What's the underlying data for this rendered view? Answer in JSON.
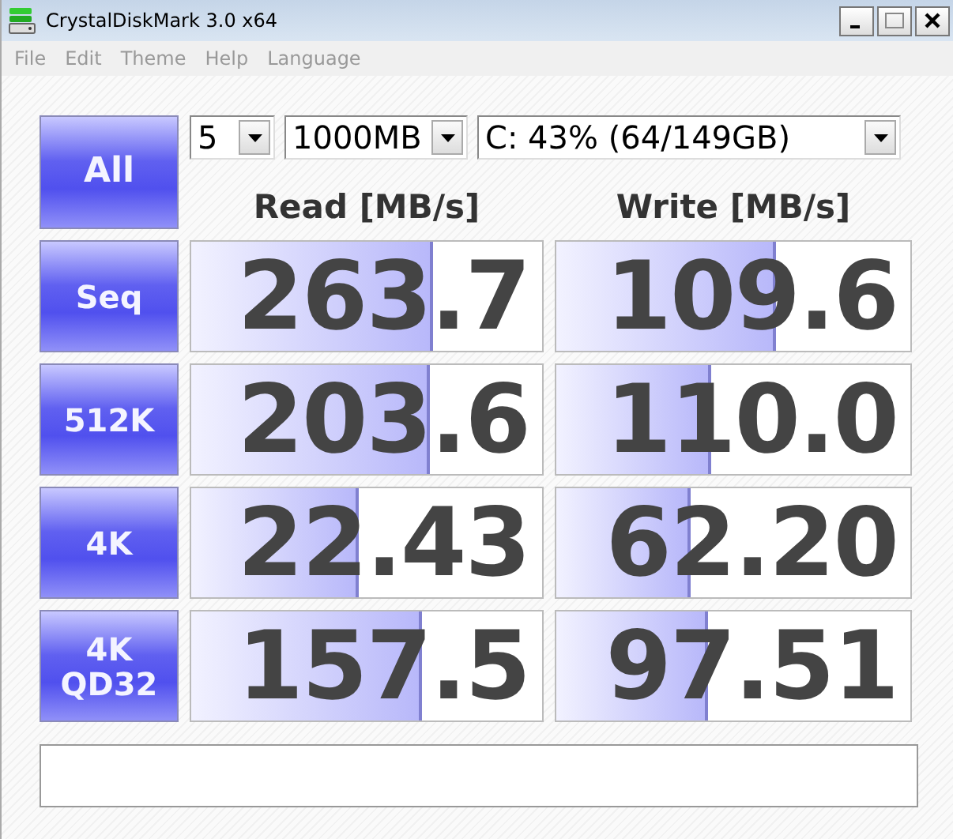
{
  "window": {
    "title": "CrystalDiskMark 3.0 x64"
  },
  "menu": [
    "File",
    "Edit",
    "Theme",
    "Help",
    "Language"
  ],
  "all_button": {
    "label": "All"
  },
  "selectors": [
    {
      "kind": "count",
      "value": "5"
    },
    {
      "kind": "size",
      "value": "1000MB"
    },
    {
      "kind": "drive",
      "value": "C: 43% (64/149GB)"
    }
  ],
  "headers": [
    "Read [MB/s]",
    "Write [MB/s]"
  ],
  "rows": [
    {
      "label": "Seq",
      "read": {
        "value": "263.7",
        "level": 0.68
      },
      "write": {
        "value": "109.6",
        "level": 0.61
      }
    },
    {
      "label": "512K",
      "read": {
        "value": "203.6",
        "level": 0.67
      },
      "write": {
        "value": "110.0",
        "level": 0.43
      }
    },
    {
      "label": "4K",
      "read": {
        "value": "22.43",
        "level": 0.47
      },
      "write": {
        "value": "62.20",
        "level": 0.37
      }
    },
    {
      "label": "4K\nQD32",
      "read": {
        "value": "157.5",
        "level": 0.65
      },
      "write": {
        "value": "97.51",
        "level": 0.42
      }
    }
  ]
}
